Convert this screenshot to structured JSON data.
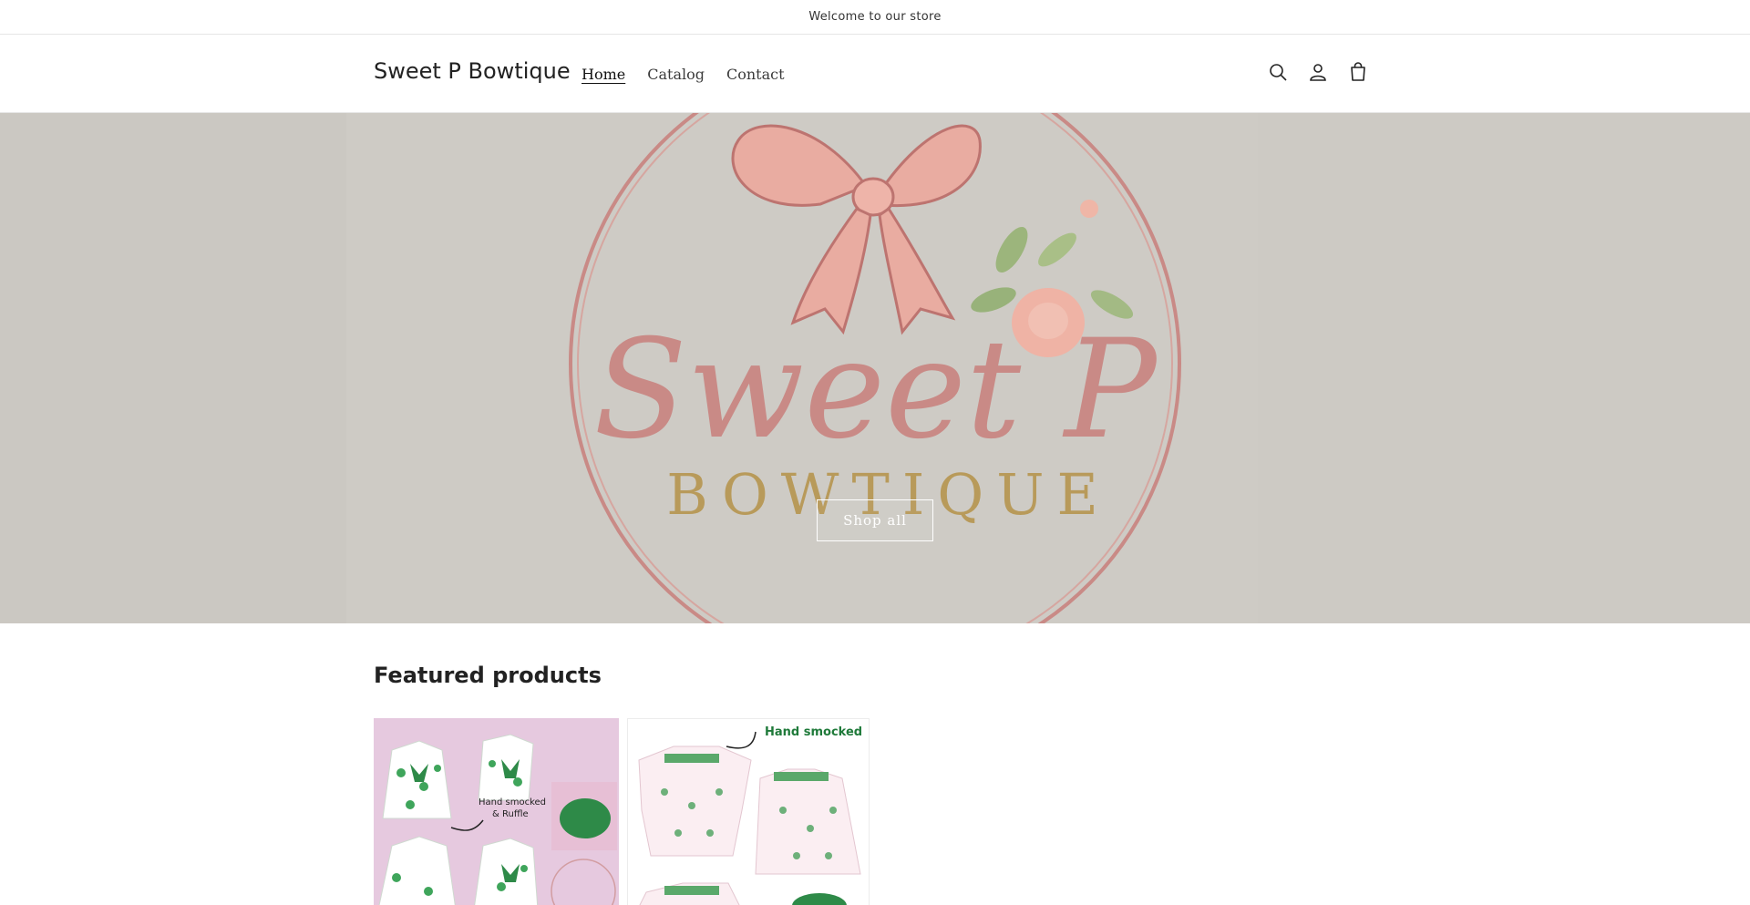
{
  "announcement": {
    "text": "Welcome to our store"
  },
  "header": {
    "brand": "Sweet P Bowtique",
    "nav": [
      {
        "label": "Home",
        "active": true
      },
      {
        "label": "Catalog",
        "active": false
      },
      {
        "label": "Contact",
        "active": false
      }
    ],
    "icons": [
      "search-icon",
      "account-icon",
      "cart-icon"
    ]
  },
  "hero": {
    "logo_text": "Sweet P",
    "logo_subtext": "BOWTIQUE",
    "button_label": "Shop all"
  },
  "featured": {
    "title": "Featured products",
    "products": [
      {
        "image_caption": "Hand smocked & Ruffle"
      },
      {
        "image_caption": "Hand smocked"
      }
    ]
  },
  "colors": {
    "hero_bg": "#cecbc5",
    "logo_pink": "#c98a86",
    "logo_gold": "#b89a5a",
    "card1_bg": "#e6c9df",
    "clover_green": "#3fa55b"
  }
}
